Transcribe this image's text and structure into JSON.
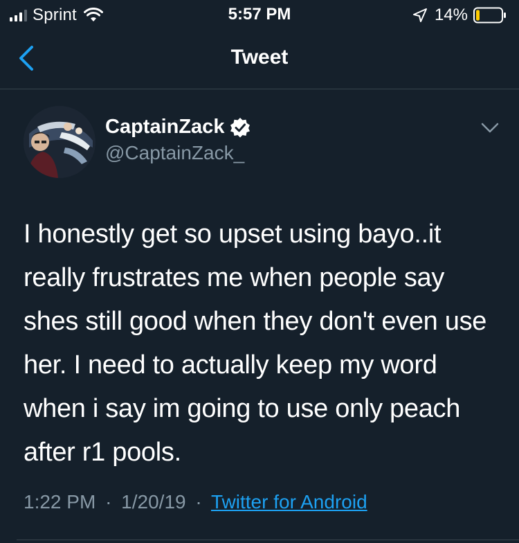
{
  "status_bar": {
    "carrier": "Sprint",
    "time": "5:57 PM",
    "battery_percent": "14%",
    "battery_level": 0.14,
    "signal_bars": 3,
    "icons": [
      "signal-icon",
      "wifi-icon",
      "location-icon",
      "battery-icon"
    ]
  },
  "nav": {
    "title": "Tweet",
    "back_icon": "chevron-left-icon"
  },
  "tweet": {
    "display_name": "CaptainZack",
    "handle": "@CaptainZack_",
    "verified": true,
    "text": "I honestly get so upset using bayo..it really frustrates me when people say shes still good when they don't even use her. I need to actually keep my word when i say im going to use only peach after r1 pools.",
    "time": "1:22 PM",
    "separator": "·",
    "date": "1/20/19",
    "source": "Twitter for Android"
  },
  "colors": {
    "background": "#15202b",
    "secondary_text": "#8899a6",
    "accent": "#1da1f2",
    "divider": "#38444d",
    "battery_low": "#ffcc00"
  }
}
